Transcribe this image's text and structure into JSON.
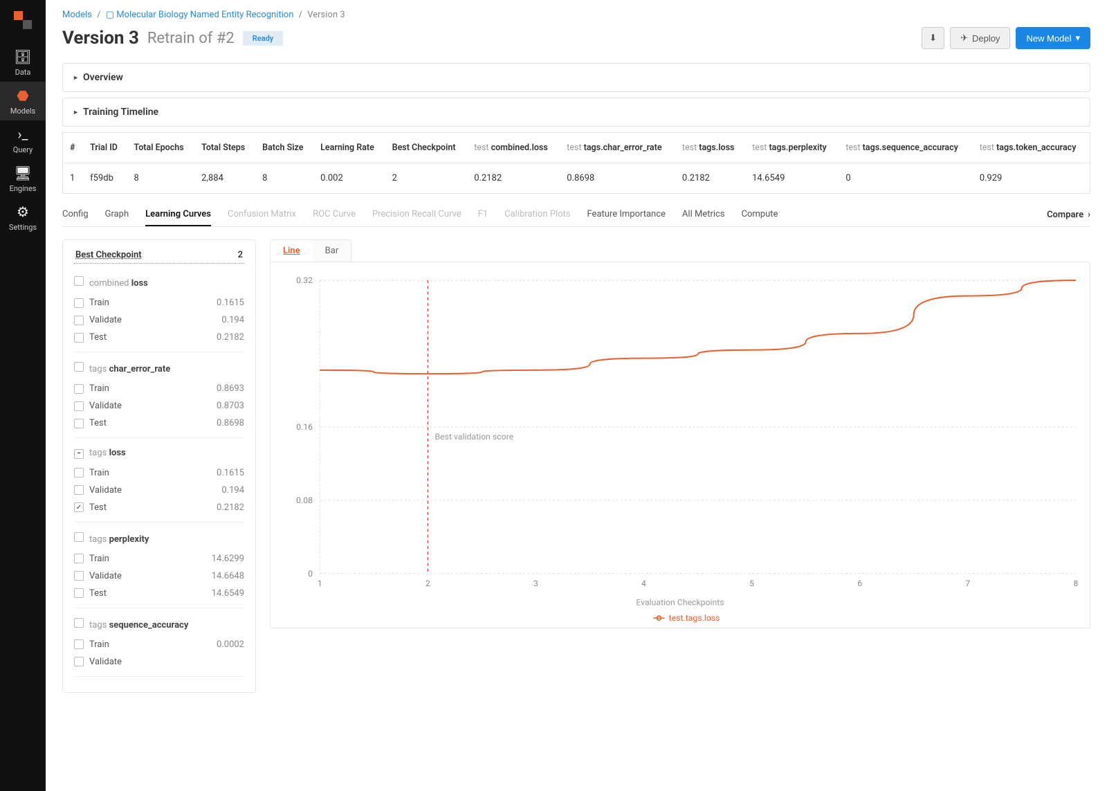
{
  "sidenav": {
    "items": [
      {
        "label": "Data",
        "icon": "database"
      },
      {
        "label": "Models",
        "icon": "models",
        "active": true
      },
      {
        "label": "Query",
        "icon": "query"
      },
      {
        "label": "Engines",
        "icon": "engines"
      },
      {
        "label": "Settings",
        "icon": "settings"
      }
    ]
  },
  "breadcrumb": {
    "root": "Models",
    "project": "Molecular Biology Named Entity Recognition",
    "current": "Version 3"
  },
  "header": {
    "title": "Version 3",
    "subtitle": "Retrain of #2",
    "badge": "Ready",
    "deploy": "Deploy",
    "new_model": "New Model"
  },
  "panels": {
    "overview": "Overview",
    "timeline": "Training Timeline"
  },
  "trial_table": {
    "cols": [
      {
        "label": "#"
      },
      {
        "label": "Trial ID"
      },
      {
        "label": "Total Epochs"
      },
      {
        "label": "Total Steps"
      },
      {
        "label": "Batch Size"
      },
      {
        "label": "Learning Rate"
      },
      {
        "label": "Best Checkpoint"
      },
      {
        "pre": "test ",
        "label": "combined.loss"
      },
      {
        "pre": "test ",
        "label": "tags.char_error_rate"
      },
      {
        "pre": "test ",
        "label": "tags.loss"
      },
      {
        "pre": "test ",
        "label": "tags.perplexity"
      },
      {
        "pre": "test ",
        "label": "tags.sequence_accuracy"
      },
      {
        "pre": "test ",
        "label": "tags.token_accuracy"
      }
    ],
    "row": {
      "num": "1",
      "trial_id": "f59db",
      "epochs": "8",
      "steps": "2,884",
      "batch": "8",
      "lr": "0.002",
      "best_ckpt": "2",
      "combined_loss": "0.2182",
      "char_err": "0.8698",
      "tags_loss": "0.2182",
      "perplexity": "14.6549",
      "seq_acc": "0",
      "token_acc": "0.929"
    }
  },
  "tabs": {
    "items": [
      {
        "label": "Config"
      },
      {
        "label": "Graph"
      },
      {
        "label": "Learning Curves",
        "active": true
      },
      {
        "label": "Confusion Matrix",
        "disabled": true
      },
      {
        "label": "ROC Curve",
        "disabled": true
      },
      {
        "label": "Precision Recall Curve",
        "disabled": true
      },
      {
        "label": "F1",
        "disabled": true
      },
      {
        "label": "Calibration Plots",
        "disabled": true
      },
      {
        "label": "Feature Importance"
      },
      {
        "label": "All Metrics"
      },
      {
        "label": "Compute"
      }
    ],
    "compare": "Compare"
  },
  "metrics_panel": {
    "header_label": "Best Checkpoint",
    "header_value": "2",
    "groups": [
      {
        "title_pre": "combined ",
        "title": "loss",
        "rows": [
          {
            "label": "Train",
            "value": "0.1615"
          },
          {
            "label": "Validate",
            "value": "0.194"
          },
          {
            "label": "Test",
            "value": "0.2182"
          }
        ]
      },
      {
        "title_pre": "tags ",
        "title": "char_error_rate",
        "rows": [
          {
            "label": "Train",
            "value": "0.8693"
          },
          {
            "label": "Validate",
            "value": "0.8703"
          },
          {
            "label": "Test",
            "value": "0.8698"
          }
        ]
      },
      {
        "title_pre": "tags ",
        "title": "loss",
        "minus": true,
        "rows": [
          {
            "label": "Train",
            "value": "0.1615"
          },
          {
            "label": "Validate",
            "value": "0.194"
          },
          {
            "label": "Test",
            "value": "0.2182",
            "checked": true
          }
        ]
      },
      {
        "title_pre": "tags ",
        "title": "perplexity",
        "rows": [
          {
            "label": "Train",
            "value": "14.6299"
          },
          {
            "label": "Validate",
            "value": "14.6648"
          },
          {
            "label": "Test",
            "value": "14.6549"
          }
        ]
      },
      {
        "title_pre": "tags ",
        "title": "sequence_accuracy",
        "rows": [
          {
            "label": "Train",
            "value": "0.0002"
          },
          {
            "label": "Validate",
            "value": ""
          }
        ]
      }
    ]
  },
  "chart": {
    "tabs": {
      "line": "Line",
      "bar": "Bar"
    },
    "xlabel": "Evaluation Checkpoints",
    "legend": "test.tags.loss",
    "annotation": "Best validation score"
  },
  "chart_data": {
    "type": "line",
    "title": "",
    "xlabel": "Evaluation Checkpoints",
    "ylabel": "",
    "x": [
      1,
      2,
      3,
      4,
      5,
      6,
      7,
      8
    ],
    "series": [
      {
        "name": "test.tags.loss",
        "values": [
          0.222,
          0.218,
          0.222,
          0.235,
          0.244,
          0.262,
          0.303,
          0.32
        ]
      }
    ],
    "yticks": [
      0,
      0.08,
      0.16,
      0.32
    ],
    "ylim": [
      0,
      0.32
    ],
    "xlim": [
      1,
      8
    ],
    "best_checkpoint_x": 2,
    "annotation": "Best validation score"
  }
}
